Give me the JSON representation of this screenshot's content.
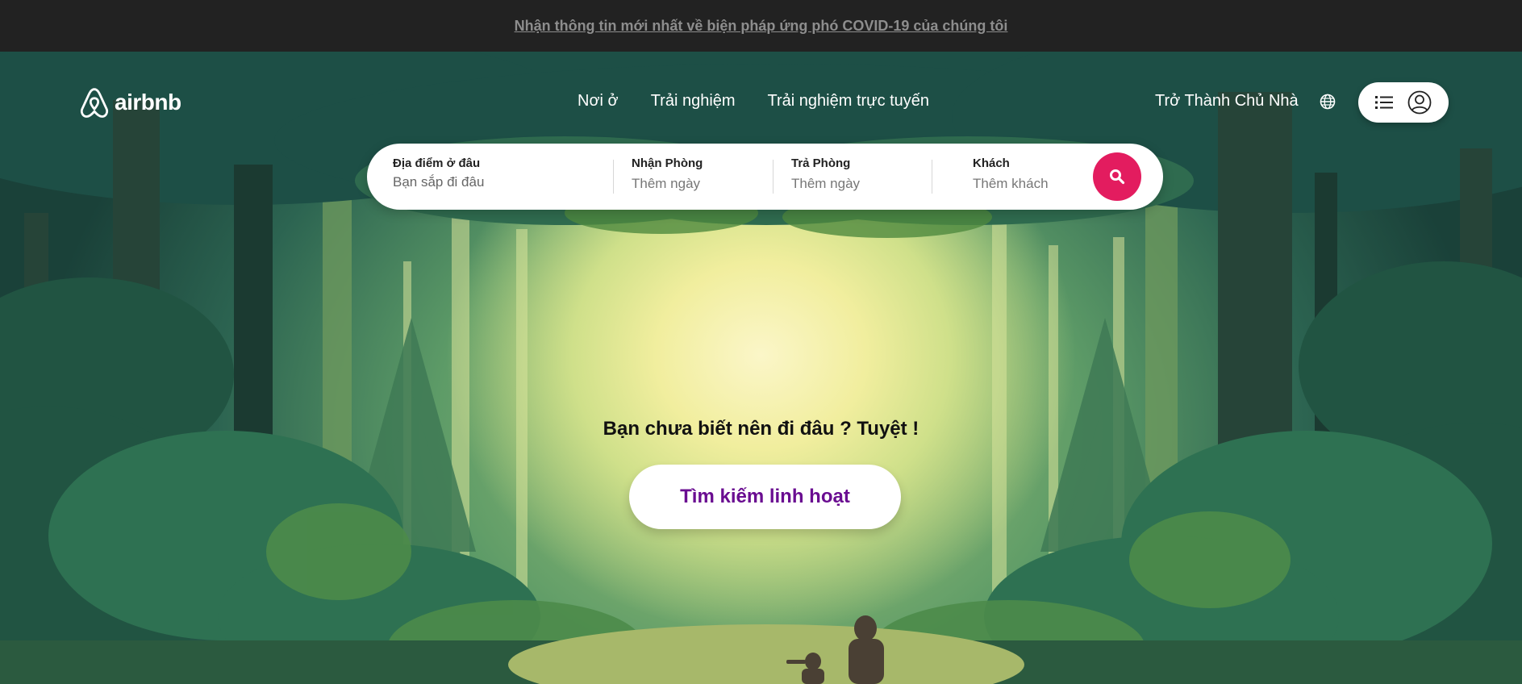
{
  "announcement": {
    "text": "Nhận thông tin mới nhất về biện pháp ứng phó COVID-19 của chúng tôi"
  },
  "header": {
    "logo_text": "airbnb",
    "nav": [
      "Nơi ở",
      "Trải nghiệm",
      "Trải nghiệm trực tuyến"
    ],
    "host_link": "Trở Thành Chủ Nhà",
    "globe_icon": "globe-icon",
    "menu_icon": "menu-list-icon",
    "user_icon": "user-avatar-icon"
  },
  "search": {
    "location_label": "Địa điểm ở đâu",
    "location_placeholder": "Bạn sắp đi đâu",
    "checkin_label": "Nhận Phòng",
    "checkin_value": "Thêm ngày",
    "checkout_label": "Trả Phòng",
    "checkout_value": "Thêm ngày",
    "guests_label": "Khách",
    "guests_value": "Thêm khách",
    "button_icon": "search-icon",
    "button_color": "#e31c5f"
  },
  "hero": {
    "tagline": "Bạn chưa biết nên đi đâu ? Tuyệt !",
    "cta_label": "Tìm kiếm linh hoạt",
    "cta_color": "#6a0d91"
  }
}
